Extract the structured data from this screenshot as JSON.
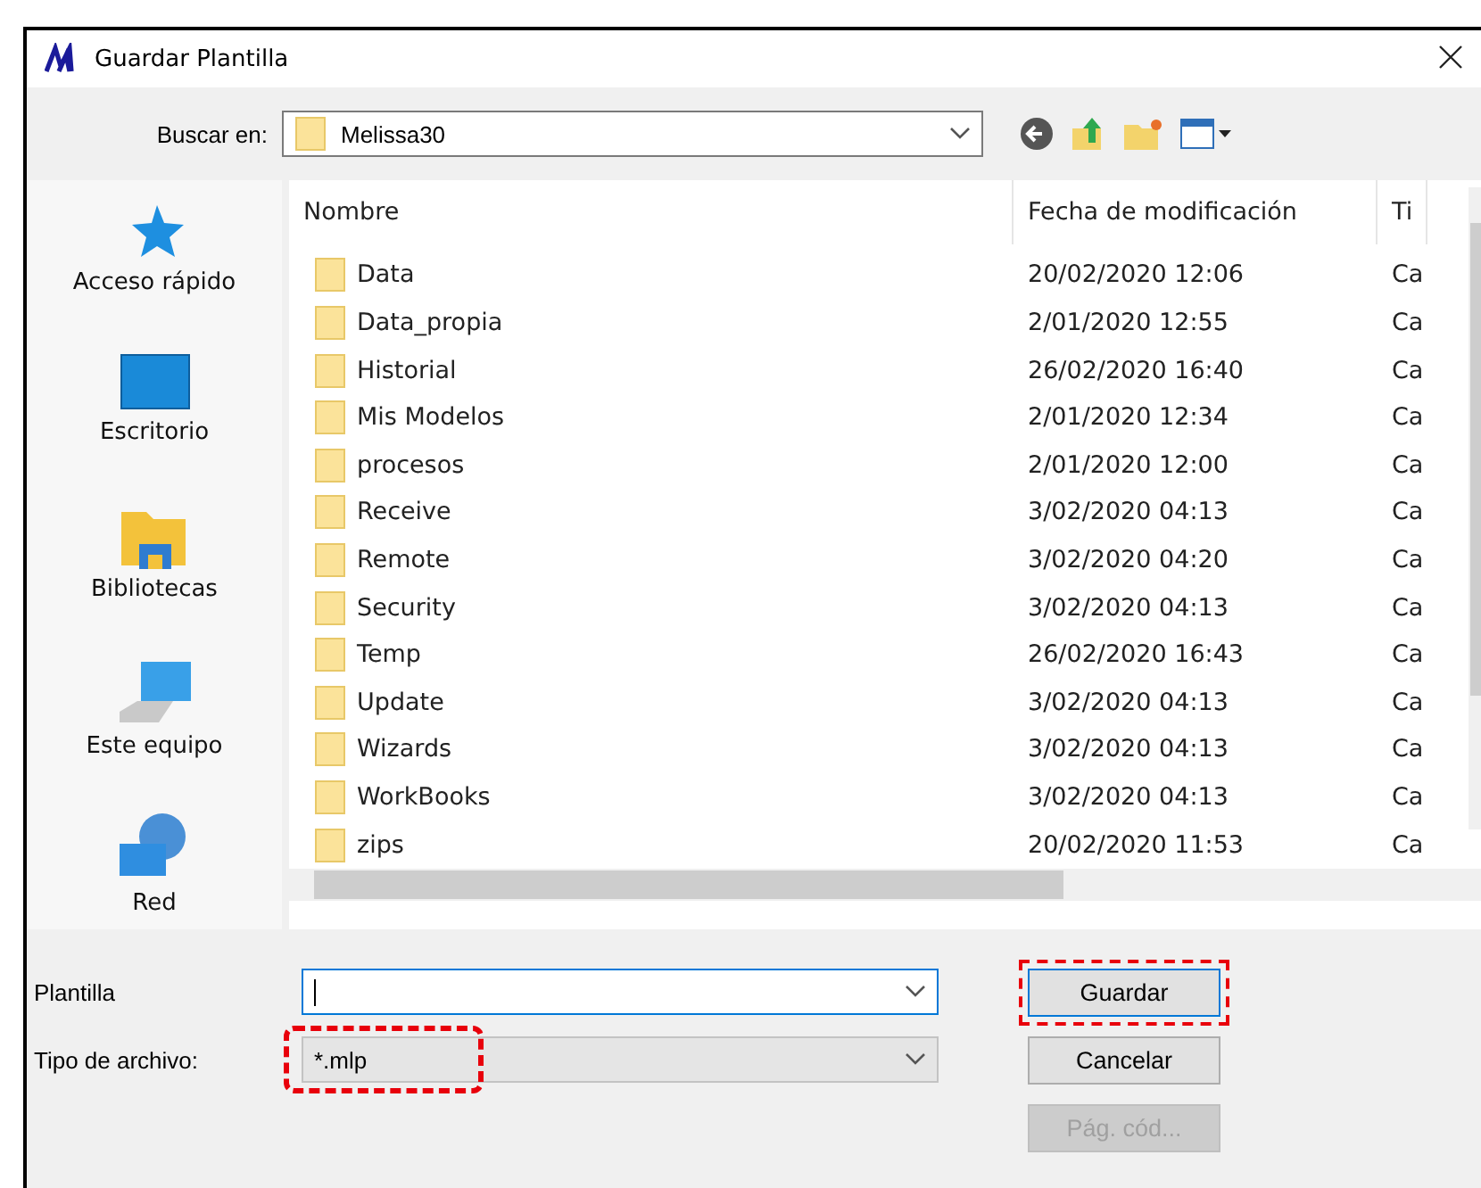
{
  "window": {
    "title": "Guardar Plantilla"
  },
  "look_in": {
    "label": "Buscar en:",
    "value": "Melissa30"
  },
  "places": [
    {
      "label": "Acceso rápido",
      "kind": "star"
    },
    {
      "label": "Escritorio",
      "kind": "desktop"
    },
    {
      "label": "Bibliotecas",
      "kind": "library"
    },
    {
      "label": "Este equipo",
      "kind": "computer"
    },
    {
      "label": "Red",
      "kind": "network"
    }
  ],
  "table": {
    "columns": [
      "Nombre",
      "Fecha de modificación",
      "Ti"
    ],
    "rows": [
      [
        "Data",
        "20/02/2020 12:06",
        "Ca"
      ],
      [
        "Data_propia",
        "2/01/2020 12:55",
        "Ca"
      ],
      [
        "Historial",
        "26/02/2020 16:40",
        "Ca"
      ],
      [
        "Mis Modelos",
        "2/01/2020 12:34",
        "Ca"
      ],
      [
        "procesos",
        "2/01/2020 12:00",
        "Ca"
      ],
      [
        "Receive",
        "3/02/2020 04:13",
        "Ca"
      ],
      [
        "Remote",
        "3/02/2020 04:20",
        "Ca"
      ],
      [
        "Security",
        "3/02/2020 04:13",
        "Ca"
      ],
      [
        "Temp",
        "26/02/2020 16:43",
        "Ca"
      ],
      [
        "Update",
        "3/02/2020 04:13",
        "Ca"
      ],
      [
        "Wizards",
        "3/02/2020 04:13",
        "Ca"
      ],
      [
        "WorkBooks",
        "3/02/2020 04:13",
        "Ca"
      ],
      [
        "zips",
        "20/02/2020 11:53",
        "Ca"
      ]
    ]
  },
  "filename": {
    "label": "Plantilla",
    "focused": true
  },
  "filetype": {
    "label": "Tipo de archivo:",
    "value": "*.mlp",
    "highlighted": true
  },
  "buttons": [
    {
      "label": "Guardar",
      "disabled": false,
      "highlighted": true
    },
    {
      "label": "Cancelar",
      "disabled": false,
      "highlighted": false
    },
    {
      "label": "Pág. cód...",
      "disabled": true,
      "highlighted": false
    }
  ]
}
